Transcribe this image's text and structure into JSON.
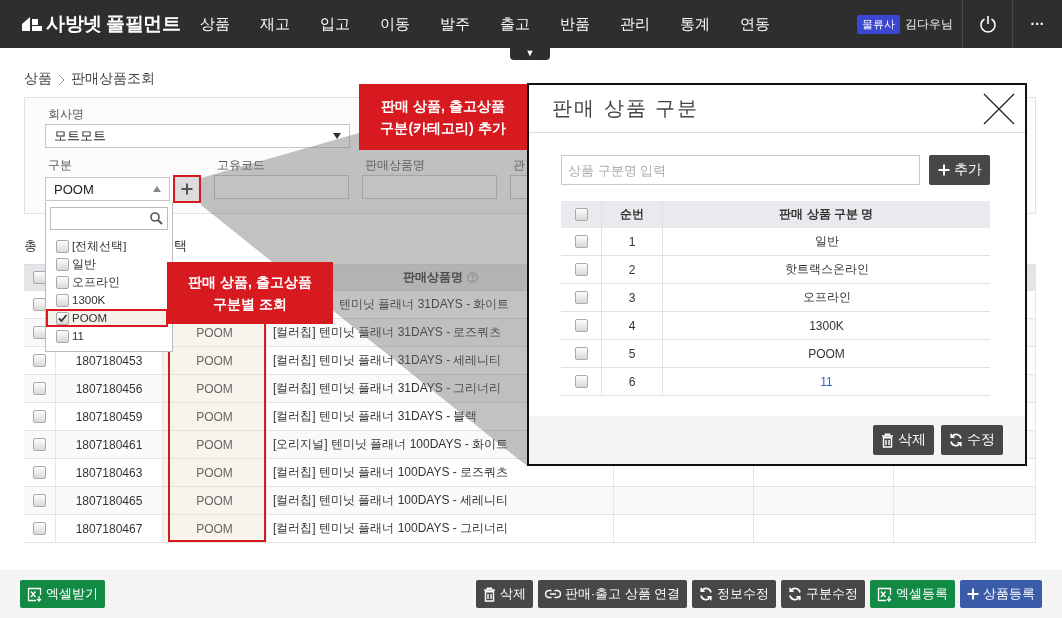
{
  "nav": {
    "logo": "사방넷 풀필먼트",
    "menu": [
      "상품",
      "재고",
      "입고",
      "이동",
      "발주",
      "출고",
      "반품",
      "관리",
      "통계",
      "연동"
    ],
    "role_badge": "물류사",
    "user": "김다우님",
    "more": "···",
    "toggle": "▼"
  },
  "breadcrumb": [
    "상품",
    "판매상품조회"
  ],
  "filters": {
    "company": {
      "label": "회사명",
      "value": "모트모트"
    },
    "category": {
      "label": "구분",
      "value": "POOM",
      "expanded": true
    },
    "fields": [
      {
        "label": "고유코드"
      },
      {
        "label": "판매상품명"
      },
      {
        "label": "관"
      }
    ]
  },
  "category_dropdown": {
    "options": [
      {
        "label": "[전체선택]",
        "checked": false,
        "selected": false
      },
      {
        "label": "일반",
        "checked": false,
        "selected": false
      },
      {
        "label": "오프라인",
        "checked": false,
        "selected": false
      },
      {
        "label": "1300K",
        "checked": false,
        "selected": false
      },
      {
        "label": "POOM",
        "checked": true,
        "selected": true
      },
      {
        "label": "11",
        "checked": false,
        "selected": false
      }
    ]
  },
  "table": {
    "total_label": "총",
    "label_fragment": "택",
    "header_checked": false,
    "name_column": {
      "label": "판매상품명",
      "help": true
    },
    "rows": [
      {
        "checked": false,
        "name": "텐미닛 플래너 31DAYS - 화이트"
      },
      {
        "checked": false,
        "category": "POOM",
        "name": "[컬러칩] 텐미닛 플래너 31DAYS - 로즈쿼츠"
      },
      {
        "checked": false,
        "code": "1807180453",
        "category": "POOM",
        "name": "[컬러칩] 텐미닛 플래너 31DAYS - 세레니티"
      },
      {
        "checked": false,
        "code": "1807180456",
        "category": "POOM",
        "name": "[컬러칩] 텐미닛 플래너 31DAYS - 그리너리"
      },
      {
        "checked": false,
        "code": "1807180459",
        "category": "POOM",
        "name": "[컬러칩] 텐미닛 플래너 31DAYS - 블랙"
      },
      {
        "checked": false,
        "code": "1807180461",
        "category": "POOM",
        "name": "[오리지널] 텐미닛 플래너 100DAYS - 화이트"
      },
      {
        "checked": false,
        "code": "1807180463",
        "category": "POOM",
        "name": "[컬러칩] 텐미닛 플래너 100DAYS - 로즈쿼츠"
      },
      {
        "checked": false,
        "code": "1807180465",
        "category": "POOM",
        "name": "[컬러칩] 텐미닛 플래너 100DAYS - 세레니티"
      },
      {
        "checked": false,
        "code": "1807180467",
        "category": "POOM",
        "name": "[컬러칩] 텐미닛 플래너 100DAYS - 그리너리"
      }
    ]
  },
  "callouts": [
    {
      "lines": [
        "판매 상품, 출고상품",
        "구분(카테고리) 추가"
      ]
    },
    {
      "lines": [
        "판매 상품, 출고상품",
        "구분별 조회"
      ]
    }
  ],
  "modal": {
    "title": "판매 상품 구분",
    "input": {
      "placeholder": "상품 구분명 입력"
    },
    "add_button": {
      "label": "추가"
    },
    "columns": [
      "순번",
      "판매 상품 구분 명"
    ],
    "header_checked": false,
    "rows": [
      {
        "checked": false,
        "no": "1",
        "name": "일반",
        "selected": false
      },
      {
        "checked": false,
        "no": "2",
        "name": "핫트랙스온라인",
        "selected": false
      },
      {
        "checked": false,
        "no": "3",
        "name": "오프라인",
        "selected": false
      },
      {
        "checked": false,
        "no": "4",
        "name": "1300K",
        "selected": false
      },
      {
        "checked": false,
        "no": "5",
        "name": "POOM",
        "selected": false
      },
      {
        "checked": false,
        "no": "6",
        "name": "11",
        "selected": true
      }
    ],
    "buttons": [
      {
        "label": "삭제"
      },
      {
        "label": "수정"
      }
    ]
  },
  "actions": {
    "left": [
      {
        "label": "엑셀받기",
        "kind": "excel"
      }
    ],
    "right": [
      {
        "label": "삭제",
        "kind": "dark"
      },
      {
        "label": "판매·출고 상품 연결",
        "kind": "dark"
      },
      {
        "label": "정보수정",
        "kind": "dark"
      },
      {
        "label": "구분수정",
        "kind": "dark"
      },
      {
        "label": "엑셀등록",
        "kind": "excel"
      },
      {
        "label": "상품등록",
        "kind": "primary"
      }
    ]
  }
}
